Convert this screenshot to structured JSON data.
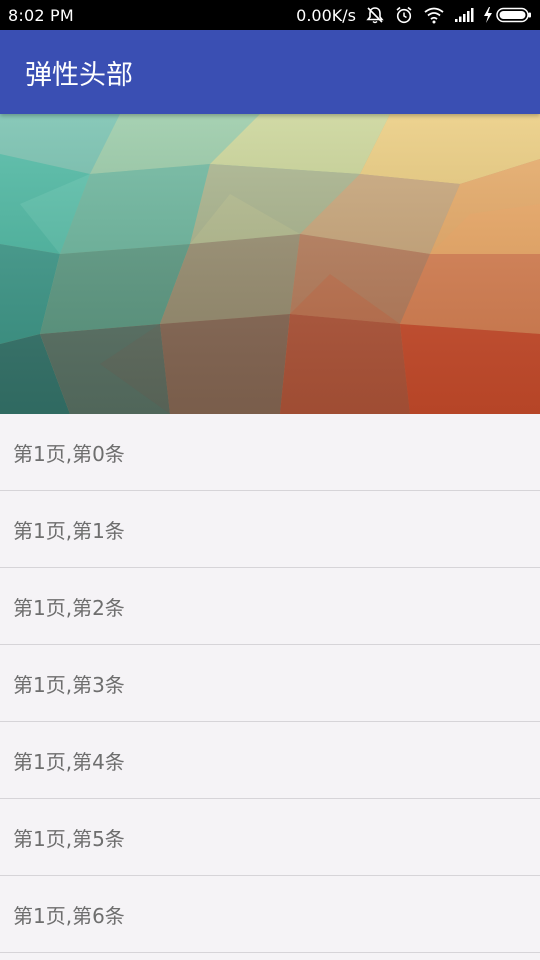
{
  "status_bar": {
    "time": "8:02 PM",
    "network_speed": "0.00K/s",
    "icons": [
      "alarm-muted-icon",
      "alarm-clock-icon",
      "wifi-icon",
      "signal-icon",
      "charging-icon",
      "battery-icon"
    ]
  },
  "app_bar": {
    "title": "弹性头部",
    "color": "#3a4fb3"
  },
  "header": {
    "image": "low-poly-gradient-banner"
  },
  "list": {
    "items": [
      {
        "label": "第1页,第0条"
      },
      {
        "label": "第1页,第1条"
      },
      {
        "label": "第1页,第2条"
      },
      {
        "label": "第1页,第3条"
      },
      {
        "label": "第1页,第4条"
      },
      {
        "label": "第1页,第5条"
      },
      {
        "label": "第1页,第6条"
      }
    ]
  }
}
